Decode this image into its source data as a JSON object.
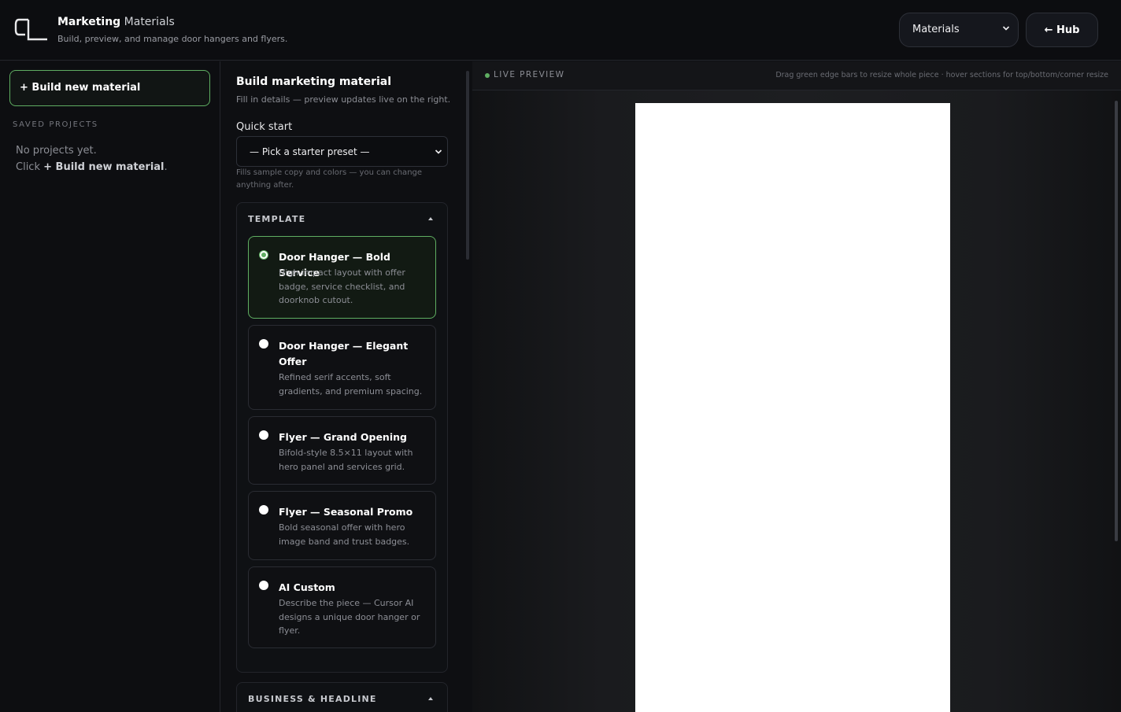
{
  "header": {
    "title_bold": "Marketing",
    "title_light": "Materials",
    "subtitle": "Build, preview, and manage door hangers and flyers.",
    "view_select": "Materials",
    "hub_label": "← Hub"
  },
  "sidebar": {
    "build_new_label": "+ Build new material",
    "saved_label": "SAVED PROJECTS",
    "empty_line1": "No projects yet.",
    "empty_line2_prefix": "Click",
    "empty_line2_bold": "+ Build new material",
    "empty_line2_suffix": "."
  },
  "form": {
    "title": "Build marketing material",
    "subtitle": "Fill in details — preview updates live on the right.",
    "quick_start_label": "Quick start",
    "quick_start_value": "— Pick a starter preset —",
    "quick_start_hint": "Fills sample copy and colors — you can change anything after.",
    "template_heading": "TEMPLATE",
    "business_heading": "BUSINESS & HEADLINE",
    "templates": [
      {
        "title": "Door Hanger — Bold Service",
        "desc": "High-impact layout with offer badge, service checklist, and doorknob cutout.",
        "selected": true
      },
      {
        "title": "Door Hanger — Elegant Offer",
        "desc": "Refined serif accents, soft gradients, and premium spacing.",
        "selected": false
      },
      {
        "title": "Flyer — Grand Opening",
        "desc": "Bifold-style 8.5×11 layout with hero panel and services grid.",
        "selected": false
      },
      {
        "title": "Flyer — Seasonal Promo",
        "desc": "Bold seasonal offer with hero image band and trust badges.",
        "selected": false
      },
      {
        "title": "AI Custom",
        "desc": "Describe the piece — Cursor AI designs a unique door hanger or flyer.",
        "selected": false
      }
    ]
  },
  "preview": {
    "label": "LIVE PREVIEW",
    "hint": "Drag green edge bars to resize whole piece · hover sections for top/bottom/corner resize"
  },
  "colors": {
    "accent": "#5fae62",
    "background": "#0f1013",
    "paper": "#ffffff"
  }
}
